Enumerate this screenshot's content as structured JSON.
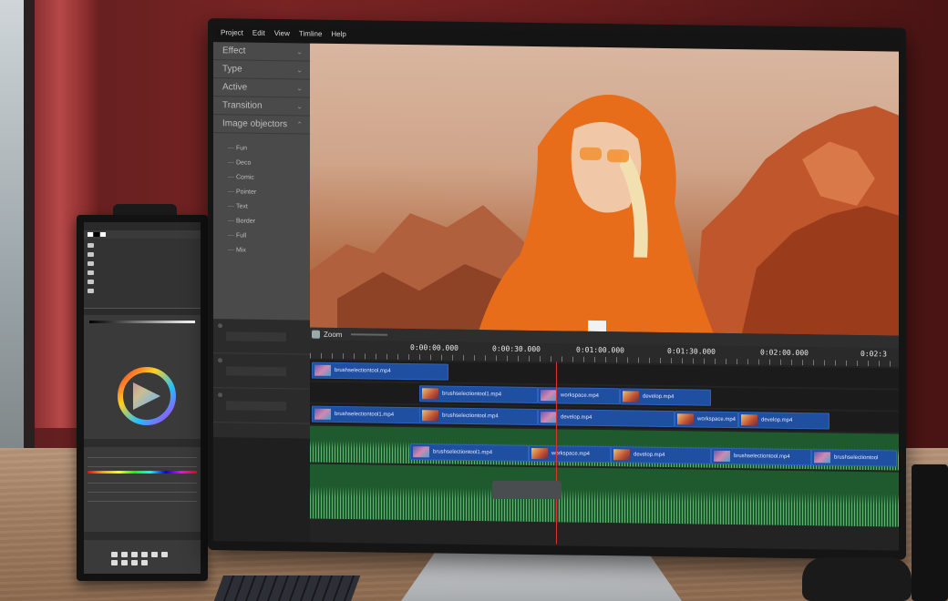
{
  "menu": [
    "Project",
    "Edit",
    "View",
    "Timline",
    "Help"
  ],
  "effects_panel": {
    "categories": [
      "Effect",
      "Type",
      "Active",
      "Transition",
      "Image objectors"
    ],
    "items": [
      "Fun",
      "Deco",
      "Comic",
      "Pointer",
      "Text",
      "Border",
      "Full",
      "Mix"
    ]
  },
  "timeline": {
    "zoom_label": "Zoom",
    "timecodes": [
      "0:00:00.000",
      "0:00:30.000",
      "0:01:00.000",
      "0:01:30.000",
      "0:02:00.000",
      "0:02:3"
    ],
    "clips": {
      "row1": [
        "brushselectiontool.mp4"
      ],
      "row2": [
        "brushselectiontool1.mp4",
        "workspace.mp4",
        "develop.mp4"
      ],
      "row3": [
        "brushselectiontool1.mp4",
        "brushselectiontool.mp4",
        "develop.mp4",
        "workspace.mp4",
        "develop.mp4"
      ],
      "row4": [
        "brushselectiontool1.mp4",
        "workspace.mp4",
        "develop.mp4",
        "brushselectiontool.mp4",
        "brushselectiontool"
      ]
    }
  },
  "colors": {
    "clip_blue": "#1f4fa0",
    "audio_green": "#1e5a2e",
    "playhead": "#e03030",
    "wall": "#6a1e1e"
  }
}
